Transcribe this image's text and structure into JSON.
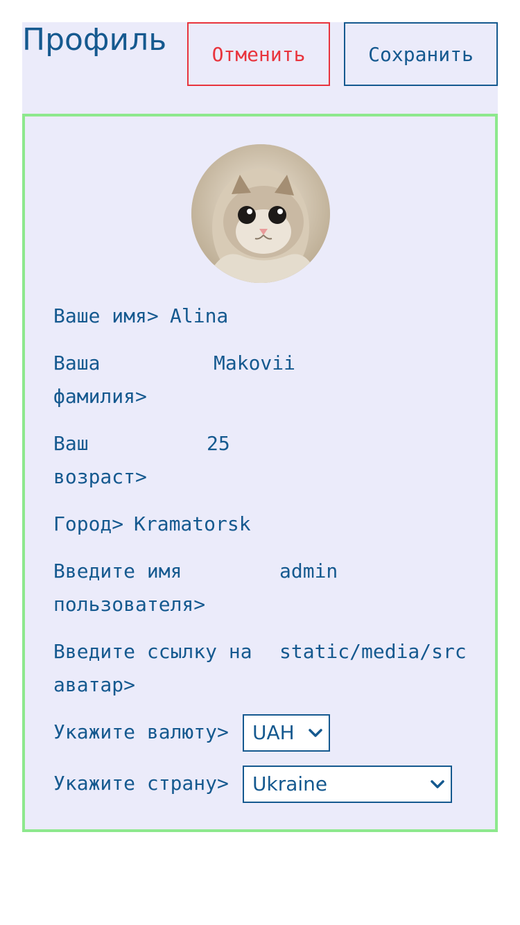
{
  "header": {
    "title": "Профиль",
    "cancel_label": "Отменить",
    "save_label": "Сохранить"
  },
  "profile": {
    "fields": [
      {
        "label": "Ваше имя>",
        "value": "Alina"
      },
      {
        "label": "Ваша фамилия>",
        "value": "Makovii"
      },
      {
        "label": "Ваш возраст>",
        "value": "25"
      },
      {
        "label": "Город>",
        "value": "Kramatorsk"
      },
      {
        "label": "Введите имя пользователя>",
        "value": "admin"
      },
      {
        "label": "Введите ссылку на аватар>",
        "value": "static/media/src"
      }
    ],
    "currency": {
      "label": "Укажите валюту>",
      "selected": "UAH"
    },
    "country": {
      "label": "Укажите страну>",
      "selected": "Ukraine"
    }
  },
  "colors": {
    "accent": "#15598f",
    "cancel": "#e8343d",
    "card_border": "#8de88d",
    "background": "#ebebfa"
  },
  "icons": {
    "avatar": "cat-avatar-icon",
    "select": "chevron-down-icon"
  }
}
